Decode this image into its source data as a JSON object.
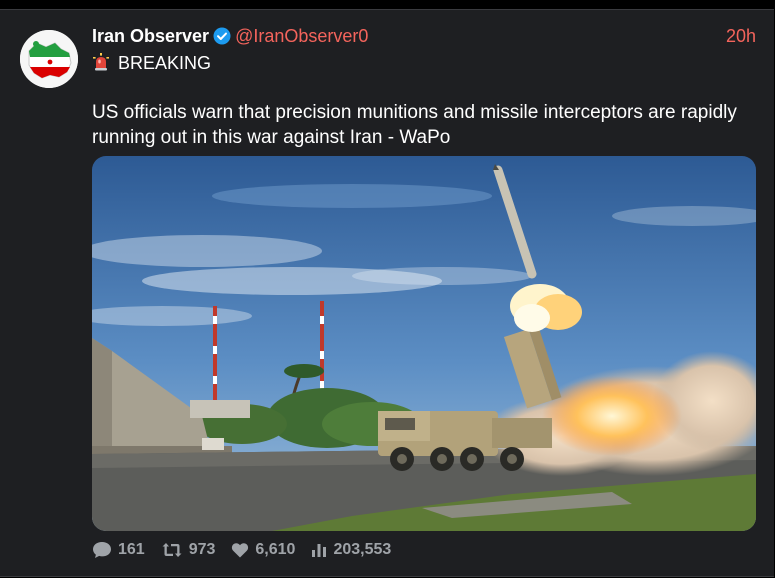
{
  "post": {
    "display_name": "Iran Observer",
    "handle": "@IranObserver0",
    "time": "20h",
    "breaking": "BREAKING",
    "text": "US officials warn that precision munitions and missile interceptors are rapidly running out in this war against Iran - WaPo",
    "verified": true
  },
  "stats": {
    "replies": "161",
    "reposts": "973",
    "likes": "6,610",
    "views": "203,553"
  },
  "colors": {
    "accent": "#f4645c",
    "verified": "#1d9bf0",
    "background": "#1e1f22",
    "muted": "#9fa3a8"
  },
  "icons": [
    "verified-badge-icon",
    "siren-icon",
    "reply-icon",
    "repost-icon",
    "like-icon",
    "views-icon"
  ]
}
